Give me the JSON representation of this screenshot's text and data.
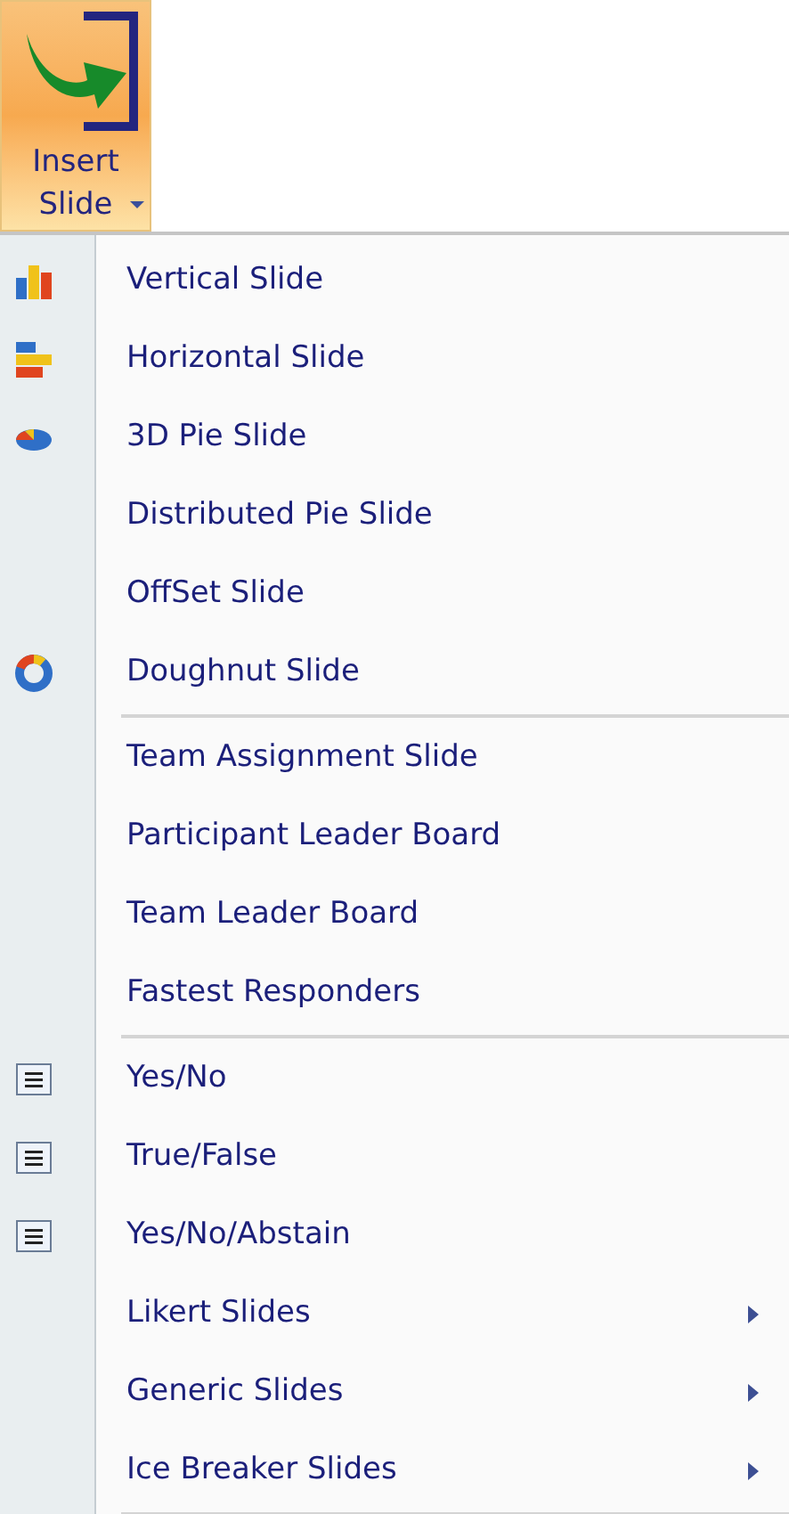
{
  "ribbon_button": {
    "label": "Insert Slide"
  },
  "menu": {
    "groups": [
      {
        "items": [
          {
            "label": "Vertical Slide",
            "kind": "vertical_bars",
            "submenu": false
          },
          {
            "label": "Horizontal Slide",
            "kind": "horizontal_bars",
            "submenu": false
          },
          {
            "label": "3D Pie Slide",
            "kind": "pie",
            "submenu": false
          },
          {
            "label": "Distributed Pie Slide",
            "submenu": false
          },
          {
            "label": "OffSet Slide",
            "submenu": false
          },
          {
            "label": "Doughnut Slide",
            "kind": "doughnut",
            "submenu": false
          }
        ]
      },
      {
        "items": [
          {
            "label": "Team Assignment Slide",
            "submenu": false
          },
          {
            "label": "Participant Leader Board",
            "submenu": false
          },
          {
            "label": "Team Leader Board",
            "submenu": false
          },
          {
            "label": "Fastest Responders",
            "submenu": false
          }
        ]
      },
      {
        "items": [
          {
            "label": "Yes/No",
            "kind": "text_lines",
            "submenu": false
          },
          {
            "label": "True/False",
            "kind": "text_lines",
            "submenu": false
          },
          {
            "label": "Yes/No/Abstain",
            "kind": "text_lines",
            "submenu": false
          },
          {
            "label": "Likert Slides",
            "submenu": true
          },
          {
            "label": "Generic Slides",
            "submenu": true
          },
          {
            "label": "Ice Breaker Slides",
            "submenu": true
          }
        ]
      }
    ]
  }
}
